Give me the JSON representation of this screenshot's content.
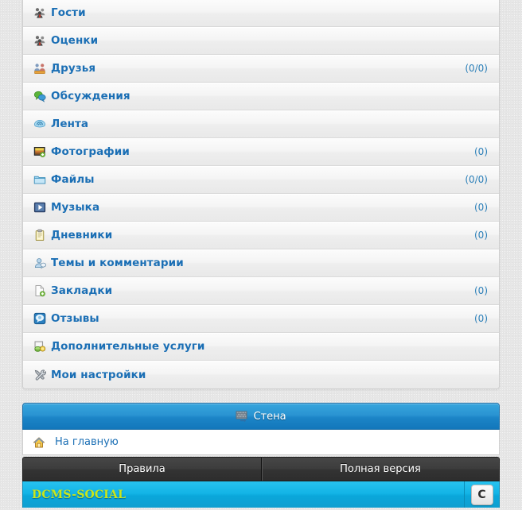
{
  "menu": {
    "items": [
      {
        "label": "Гости",
        "count": "",
        "icon": "guests-icon"
      },
      {
        "label": "Оценки",
        "count": "",
        "icon": "ratings-icon"
      },
      {
        "label": "Друзья",
        "count": "(0/0)",
        "icon": "friends-icon"
      },
      {
        "label": "Обсуждения",
        "count": "",
        "icon": "discussions-icon"
      },
      {
        "label": "Лента",
        "count": "",
        "icon": "feed-icon"
      },
      {
        "label": "Фотографии",
        "count": "(0)",
        "icon": "photos-icon"
      },
      {
        "label": "Файлы",
        "count": "(0/0)",
        "icon": "files-icon"
      },
      {
        "label": "Музыка",
        "count": "(0)",
        "icon": "music-icon"
      },
      {
        "label": "Дневники",
        "count": "(0)",
        "icon": "diaries-icon"
      },
      {
        "label": "Темы и комментарии",
        "count": "",
        "icon": "topics-comments-icon"
      },
      {
        "label": "Закладки",
        "count": "(0)",
        "icon": "bookmarks-icon"
      },
      {
        "label": "Отзывы",
        "count": "(0)",
        "icon": "reviews-icon"
      },
      {
        "label": "Дополнительные услуги",
        "count": "",
        "icon": "extra-services-icon"
      },
      {
        "label": "Мои настройки",
        "count": "",
        "icon": "my-settings-icon"
      }
    ]
  },
  "wall": {
    "label": "Стена",
    "icon": "wall-icon"
  },
  "home": {
    "label": "На главную",
    "icon": "home-icon"
  },
  "dark_nav": {
    "rules_label": "Правила",
    "full_version_label": "Полная версия"
  },
  "footer": {
    "brand": "DCMS-SOCIAL",
    "counter_label": "C"
  },
  "colors": {
    "link_blue": "#1b6fb5",
    "count_blue": "#2b7fb8",
    "wall_blue": "#1c85c7",
    "footer_cyan": "#10b6e8",
    "brand_yellow": "#c8e61e",
    "dark_nav": "#3a3a3a",
    "row_bg": "#f3f3f3",
    "page_bg": "#e6e6e6"
  }
}
